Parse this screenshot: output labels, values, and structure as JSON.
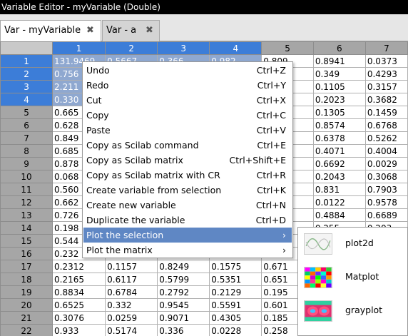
{
  "window": {
    "title": "Variable Editor - myVariable  (Double)"
  },
  "tabs": [
    {
      "label": "Var - myVariable",
      "close": "✖",
      "active": true
    },
    {
      "label": "Var - a",
      "close": "✖",
      "active": false
    }
  ],
  "grid": {
    "columns": [
      "1",
      "2",
      "3",
      "4",
      "5",
      "6",
      "7"
    ],
    "selected_columns": [
      "1",
      "2",
      "3",
      "4"
    ],
    "rows": [
      {
        "label": "1",
        "cells": [
          "131.9469",
          "0.5667",
          "0.366",
          "0.982",
          "0.809",
          "0.8941",
          "0.0373"
        ]
      },
      {
        "label": "2",
        "cells": [
          "0.756",
          "",
          "",
          "",
          "82",
          "0.349",
          "0.4293"
        ]
      },
      {
        "label": "3",
        "cells": [
          "2.211",
          "",
          "",
          "",
          "",
          "0.1105",
          "0.3157"
        ]
      },
      {
        "label": "4",
        "cells": [
          "0.330",
          "",
          "",
          "",
          "31",
          "0.2023",
          "0.3682"
        ]
      },
      {
        "label": "5",
        "cells": [
          "0.665",
          "",
          "",
          "",
          "92",
          "0.1305",
          "0.1459"
        ]
      },
      {
        "label": "6",
        "cells": [
          "0.628",
          "",
          "",
          "",
          "03",
          "0.8574",
          "0.6768"
        ]
      },
      {
        "label": "7",
        "cells": [
          "0.849",
          "",
          "",
          "",
          "55",
          "0.6378",
          "0.5262"
        ]
      },
      {
        "label": "8",
        "cells": [
          "0.685",
          "",
          "",
          "",
          ".4",
          "0.4071",
          "0.4004"
        ]
      },
      {
        "label": "9",
        "cells": [
          "0.878",
          "",
          "",
          "",
          "34",
          "0.6692",
          "0.0029"
        ]
      },
      {
        "label": "10",
        "cells": [
          "0.068",
          "",
          "",
          "",
          "94",
          "0.2043",
          "0.3068"
        ]
      },
      {
        "label": "11",
        "cells": [
          "0.560",
          "",
          "",
          "",
          "52",
          "0.831",
          "0.7903"
        ]
      },
      {
        "label": "12",
        "cells": [
          "0.662",
          "",
          "",
          "",
          "",
          "0.0122",
          "0.9578"
        ]
      },
      {
        "label": "13",
        "cells": [
          "0.726",
          "",
          "",
          "",
          "46",
          "0.4884",
          "0.6689"
        ]
      },
      {
        "label": "14",
        "cells": [
          "0.198",
          "",
          "",
          "",
          "",
          "0.255",
          "0.203"
        ]
      },
      {
        "label": "15",
        "cells": [
          "0.544",
          "",
          "",
          "",
          "",
          "",
          "24"
        ]
      },
      {
        "label": "16",
        "cells": [
          "0.232",
          "",
          "",
          "",
          "",
          "",
          "48"
        ]
      },
      {
        "label": "17",
        "cells": [
          "0.2312",
          "0.1157",
          "0.8249",
          "0.1575",
          "0.671",
          "",
          "24"
        ]
      },
      {
        "label": "18",
        "cells": [
          "0.2165",
          "0.6117",
          "0.5799",
          "0.5351",
          "0.651",
          "",
          "81"
        ]
      },
      {
        "label": "19",
        "cells": [
          "0.8834",
          "0.6784",
          "0.2792",
          "0.2129",
          "0.195",
          "",
          "08"
        ]
      },
      {
        "label": "20",
        "cells": [
          "0.6525",
          "0.332",
          "0.9545",
          "0.5591",
          "0.601",
          "",
          "58"
        ]
      },
      {
        "label": "21",
        "cells": [
          "0.3076",
          "0.0259",
          "0.9071",
          "0.4305",
          "0.185",
          "",
          "77"
        ]
      },
      {
        "label": "22",
        "cells": [
          "0.933",
          "0.5174",
          "0.336",
          "0.0228",
          "0.258",
          "",
          "22"
        ]
      }
    ]
  },
  "context_menu": {
    "items": [
      {
        "label": "Undo",
        "shortcut": "Ctrl+Z"
      },
      {
        "label": "Redo",
        "shortcut": "Ctrl+Y"
      },
      {
        "label": "Cut",
        "shortcut": "Ctrl+X"
      },
      {
        "label": "Copy",
        "shortcut": "Ctrl+C"
      },
      {
        "label": "Paste",
        "shortcut": "Ctrl+V"
      },
      {
        "label": "Copy as Scilab command",
        "shortcut": "Ctrl+E"
      },
      {
        "label": "Copy as Scilab matrix",
        "shortcut": "Ctrl+Shift+E"
      },
      {
        "label": "Copy as Scilab matrix with CR",
        "shortcut": "Ctrl+R"
      },
      {
        "label": "Create variable from selection",
        "shortcut": "Ctrl+K"
      },
      {
        "label": "Create new variable",
        "shortcut": "Ctrl+N"
      },
      {
        "label": "Duplicate the variable",
        "shortcut": "Ctrl+D"
      },
      {
        "label": "Plot the selection",
        "shortcut": "›",
        "highlighted": true
      },
      {
        "label": "Plot the matrix",
        "shortcut": "›"
      }
    ]
  },
  "submenu": {
    "items": [
      {
        "label": "plot2d",
        "icon": "plot2d-thumbnail-icon"
      },
      {
        "label": "Matplot",
        "icon": "matplot-thumbnail-icon"
      },
      {
        "label": "grayplot",
        "icon": "grayplot-thumbnail-icon"
      }
    ]
  },
  "colors": {
    "selection_header": "#3c7dd8",
    "selection_cells": "#8fa8d0",
    "menu_highlight": "#5f87c4",
    "header_gray": "#a6a6a6"
  }
}
